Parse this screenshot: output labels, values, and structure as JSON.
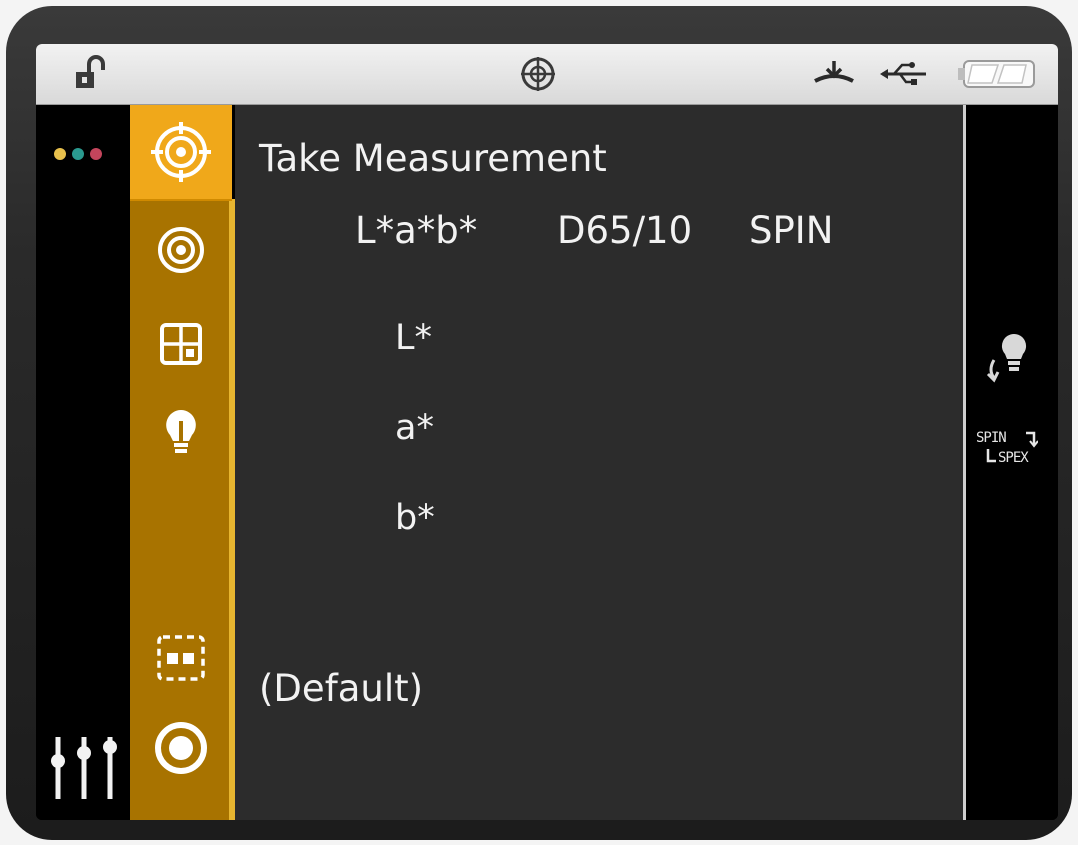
{
  "screen": {
    "title": "Take Measurement",
    "color_space": "L*a*b*",
    "illuminant_observer": "D65/10",
    "mode": "SPIN",
    "fields": [
      {
        "label": "L*"
      },
      {
        "label": "a*"
      },
      {
        "label": "b*"
      }
    ],
    "job_label": "(Default)"
  },
  "status_bar": {
    "icons": [
      "unlock-icon",
      "target-icon",
      "calibration-tile-icon",
      "usb-icon",
      "battery-icon"
    ]
  },
  "left_tabs": [
    {
      "icon": "measure-target-icon",
      "active": true
    },
    {
      "icon": "concentric-circle-icon",
      "active": false
    },
    {
      "icon": "grid-icon",
      "active": false
    },
    {
      "icon": "lightbulb-icon",
      "active": false
    },
    {
      "icon": "dashed-box-icon",
      "active": false
    },
    {
      "icon": "ring-icon",
      "active": false
    }
  ],
  "side_controls": {
    "mode_toggle_line1": "SPIN",
    "mode_toggle_line2": "SPEX",
    "illuminant_icon": "lightbulb-cycle-icon",
    "settings_icon": "sliders-icon",
    "menu_icon": "three-dots-icon"
  },
  "colors": {
    "tab_active": "#f0a81a",
    "tab_strip": "#a87300",
    "panel": "#2c2c2c",
    "dot_yellow": "#e8c04c",
    "dot_teal": "#2a9a8f",
    "dot_red": "#c4455c"
  }
}
